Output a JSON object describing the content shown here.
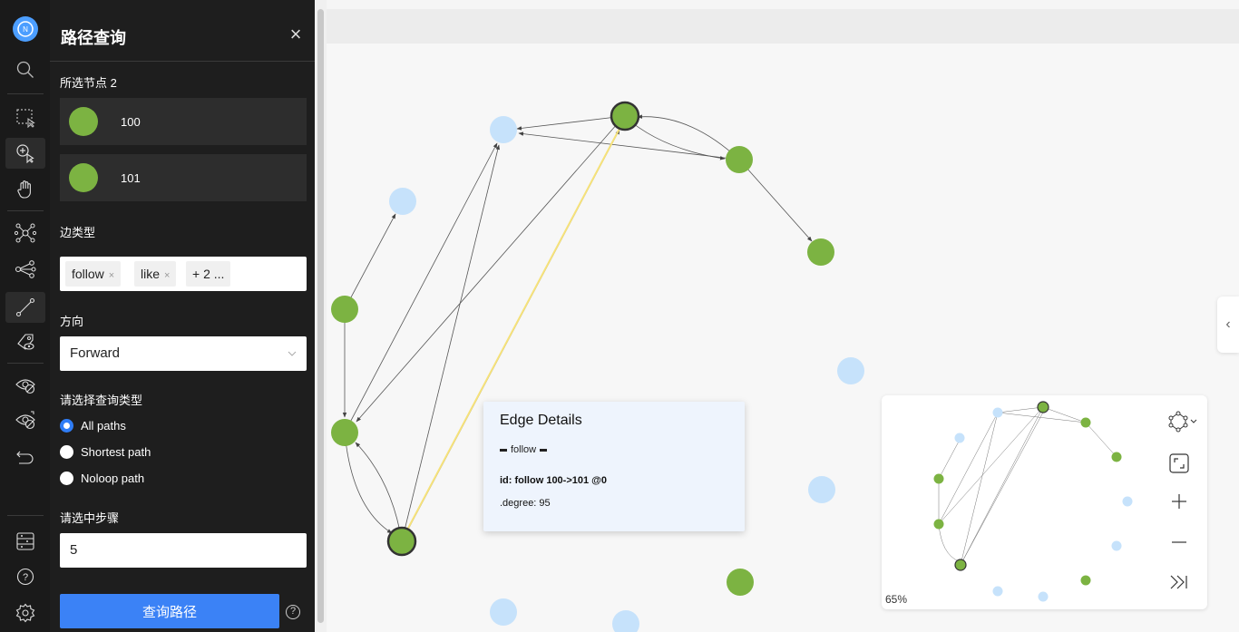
{
  "panel": {
    "title": "路径查询",
    "selected_label": "所选节点 2",
    "selected_nodes": [
      {
        "name": "100",
        "color": "#7cb342"
      },
      {
        "name": "101",
        "color": "#7cb342"
      }
    ],
    "edge_type_label": "边类型",
    "edge_tags": [
      "follow",
      "like"
    ],
    "edge_more": "+ 2 ...",
    "direction_label": "方向",
    "direction_value": "Forward",
    "query_type_label": "请选择查询类型",
    "query_types": [
      {
        "label": "All paths",
        "checked": true
      },
      {
        "label": "Shortest path",
        "checked": false
      },
      {
        "label": "Noloop path",
        "checked": false
      }
    ],
    "steps_label": "请选中步骤",
    "steps_value": "5",
    "query_button": "查询路径"
  },
  "edge_tooltip": {
    "title": "Edge Details",
    "type": "follow",
    "id": "id: follow 100->101 @0",
    "degree": ".degree: 95"
  },
  "minimap": {
    "zoom": "65%"
  },
  "colors": {
    "green_node": "#7cb342",
    "blue_node": "#c6e2fb",
    "highlight_edge": "#f6e27a",
    "primary": "#3b82f6",
    "rail_bg": "#1a1a1a",
    "panel_bg": "#1e1e1e"
  },
  "icons": {
    "rail": [
      "logo-icon",
      "search-icon",
      "box-select-icon",
      "add-select-icon",
      "hand-icon",
      "expand-nodes-icon",
      "share-icon",
      "path-icon",
      "tag-view-icon",
      "hide-icon",
      "show-hidden-icon",
      "undo-icon",
      "list-settings-icon",
      "help-icon",
      "settings-icon"
    ],
    "minimap_tools": [
      "layout-icon",
      "fit-icon",
      "zoom-in-icon",
      "zoom-out-icon",
      "expand-icon"
    ]
  }
}
